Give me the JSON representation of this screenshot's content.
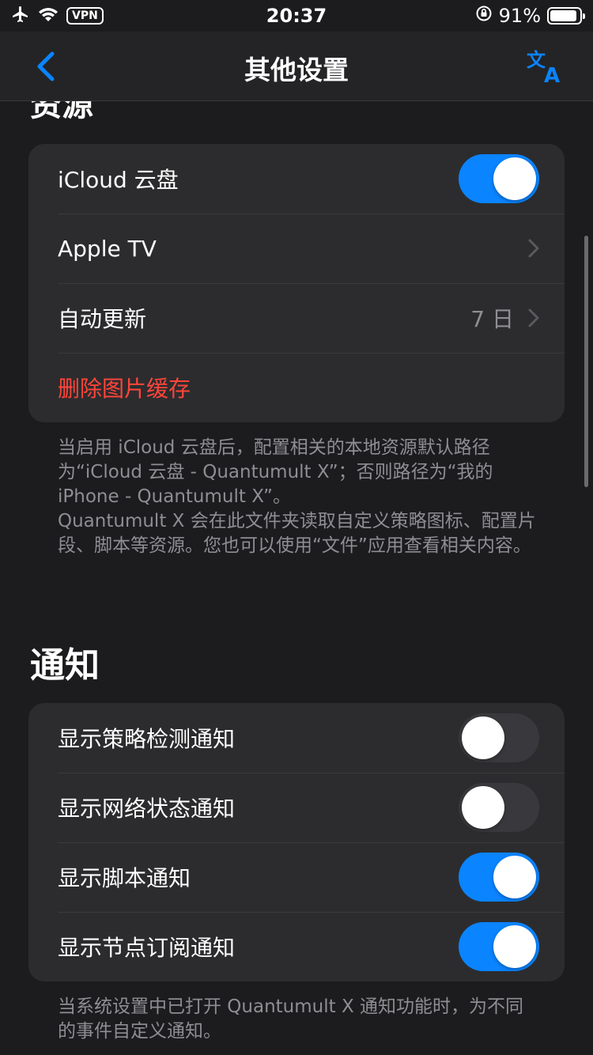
{
  "status_bar": {
    "time": "20:37",
    "vpn": "VPN",
    "battery_percent": "91%",
    "battery_level": 0.91
  },
  "nav": {
    "title": "其他设置",
    "back_icon": "chevron-left-icon",
    "translate_icon": "translate-icon"
  },
  "resources": {
    "title": "资源",
    "rows": [
      {
        "label": "iCloud 云盘",
        "toggle": true
      },
      {
        "label": "Apple TV"
      },
      {
        "label": "自动更新",
        "value": "7 日"
      },
      {
        "label": "删除图片缓存"
      }
    ],
    "footnote": "当启用 iCloud 云盘后，配置相关的本地资源默认路径为“iCloud 云盘 - Quantumult X”；否则路径为“我的 iPhone - Quantumult X”。\nQuantumult X 会在此文件夹读取自定义策略图标、配置片段、脚本等资源。您也可以使用“文件”应用查看相关内容。"
  },
  "notifications": {
    "title": "通知",
    "rows": [
      {
        "label": "显示策略检测通知",
        "toggle": false
      },
      {
        "label": "显示网络状态通知",
        "toggle": false
      },
      {
        "label": "显示脚本通知",
        "toggle": true
      },
      {
        "label": "显示节点订阅通知",
        "toggle": true
      }
    ],
    "footnote": "当系统设置中已打开 Quantumult X 通知功能时，为不同的事件自定义通知。"
  },
  "colors": {
    "accent": "#0a84ff",
    "danger": "#ff453a",
    "background": "#1c1c1e",
    "cell": "#2c2c2e"
  }
}
